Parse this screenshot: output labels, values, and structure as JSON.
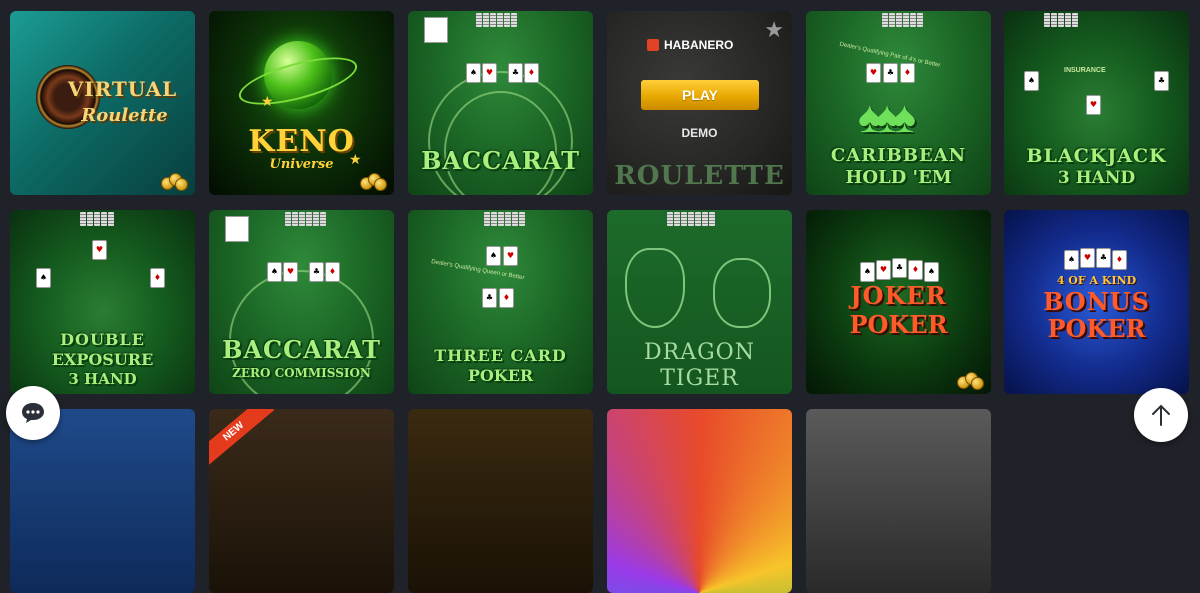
{
  "games": [
    {
      "id": "virtual-roulette",
      "title_line1": "VIRTUAL",
      "title_line2": "Roulette",
      "coins": true
    },
    {
      "id": "keno-universe",
      "title_line1": "KENO",
      "title_line2": "Universe",
      "coins": true
    },
    {
      "id": "baccarat",
      "title_line1": "BACCARAT"
    },
    {
      "id": "roulette",
      "title_line1": "ROULETTE",
      "provider": "HABANERO",
      "play_label": "PLAY",
      "demo_label": "DEMO"
    },
    {
      "id": "caribbean-holdem",
      "title_line1": "CARIBBEAN",
      "title_line2": "HOLD 'EM",
      "table_text": "Dealer's Qualifying Pair of 4's or Better"
    },
    {
      "id": "blackjack-3-hand",
      "title_line1": "BLACKJACK",
      "title_line2": "3 HAND",
      "table_text": "INSURANCE"
    },
    {
      "id": "double-exposure",
      "title_line1": "DOUBLE",
      "title_line2": "EXPOSURE",
      "title_line3": "3 HAND"
    },
    {
      "id": "baccarat-zero",
      "title_line1": "BACCARAT",
      "title_line2": "ZERO COMMISSION"
    },
    {
      "id": "three-card-poker",
      "title_line1": "THREE CARD",
      "title_line2": "POKER",
      "table_text": "Dealer's Qualifying Queen or Better"
    },
    {
      "id": "dragon-tiger",
      "title_line1": "DRAGON",
      "title_line2": "TIGER"
    },
    {
      "id": "joker-poker",
      "title_line1": "JOKER",
      "title_line2": "POKER",
      "coins": true
    },
    {
      "id": "bonus-poker",
      "title_line1": "4 OF A KIND",
      "title_line2": "BONUS",
      "title_line3": "POKER"
    }
  ],
  "partial_row": {
    "new_badge": "NEW"
  },
  "colors": {
    "page_bg": "#1f2228",
    "play_button": "#e8a800",
    "new_badge": "#e43b1d"
  },
  "icons": {
    "chat": "chat-bubble-icon",
    "scroll_top": "arrow-up-icon",
    "favorite": "star-icon",
    "provider": "habanero-logo-icon"
  }
}
